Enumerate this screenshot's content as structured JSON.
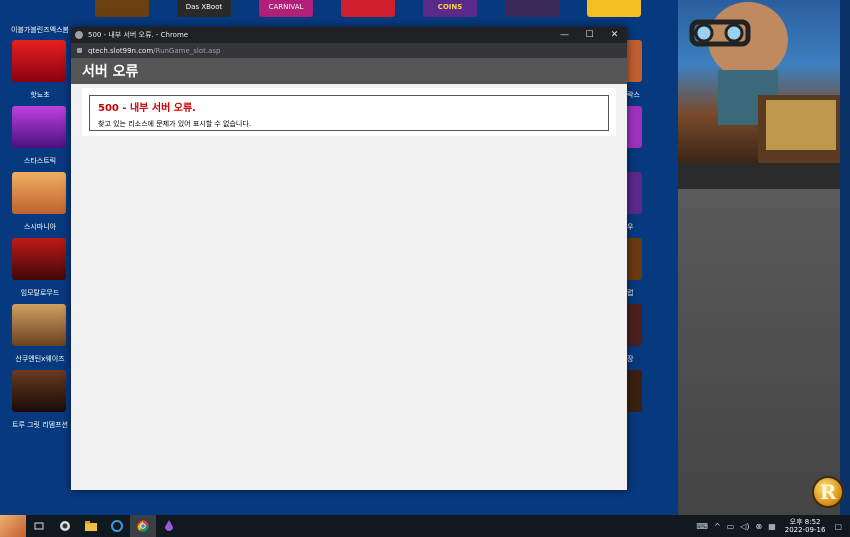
{
  "background": {
    "games": [
      {
        "label": "이블가블린즈엑스봄",
        "color": "#7a5a2a"
      },
      {
        "label": "핫뇨초",
        "color": "#c0181e"
      },
      {
        "label": "스타스트릭",
        "color": "#8a2ab0"
      },
      {
        "label": "스시마니아",
        "color": "#e8a04a"
      },
      {
        "label": "임모탈로무드",
        "color": "#a01010"
      },
      {
        "label": "산쿠엔틴x웨이즈",
        "color": "#c08040"
      },
      {
        "label": "트루 그릿 리뎀프션",
        "color": "#5a3020"
      }
    ],
    "top_thumbs": [
      {
        "text": "",
        "color": "#6a4010"
      },
      {
        "text": "Das XBoot",
        "color": "#2a2a2a"
      },
      {
        "text": "CARNIVAL",
        "color": "#b0207a"
      },
      {
        "text": "",
        "color": "#d02030"
      },
      {
        "text": "COINS",
        "color": "#5a2a8a"
      },
      {
        "text": "",
        "color": "#3a2a5a"
      },
      {
        "text": "",
        "color": "#f0c020"
      }
    ],
    "peek_labels": [
      "락스",
      "우",
      "럽",
      "장"
    ],
    "badge_letter": "R"
  },
  "window": {
    "title": "500 - 내부 서버 오류. - Chrome",
    "minimize": "—",
    "maximize": "☐",
    "close": "✕",
    "url_host": "qtech.slot99n.com",
    "url_path": "/RunGame_slot.asp"
  },
  "page": {
    "header": "서버 오류",
    "error_title": "500 - 내부 서버 오류.",
    "error_desc": "찾고 있는 리소스에 문제가 있어 표시할 수 없습니다."
  },
  "taskbar": {
    "clock_time": "오후 8:52",
    "clock_date": "2022-09-16",
    "notification": "▢"
  }
}
